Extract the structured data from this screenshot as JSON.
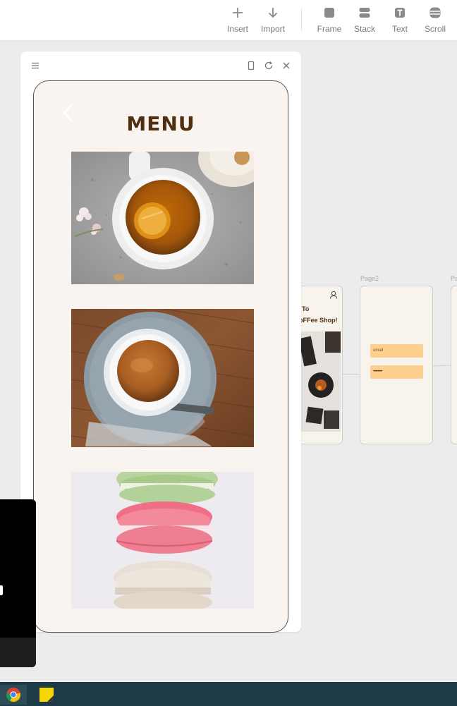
{
  "toolbar": {
    "tools": [
      {
        "id": "insert",
        "label": "Insert",
        "icon": "plus-icon"
      },
      {
        "id": "import",
        "label": "Import",
        "icon": "arrow-down-icon"
      },
      {
        "id": "frame",
        "label": "Frame",
        "icon": "frame-icon"
      },
      {
        "id": "stack",
        "label": "Stack",
        "icon": "stack-icon"
      },
      {
        "id": "text",
        "label": "Text",
        "icon": "text-icon"
      },
      {
        "id": "scroll",
        "label": "Scroll",
        "icon": "scroll-icon"
      }
    ]
  },
  "preview": {
    "controls": [
      "menu-icon",
      "device-icon",
      "refresh-icon",
      "close-icon"
    ],
    "screen": {
      "title": "MENU",
      "items": [
        {
          "name": "tea",
          "icon": "tea-photo"
        },
        {
          "name": "espresso",
          "icon": "espresso-photo"
        },
        {
          "name": "macarons",
          "icon": "macarons-photo"
        }
      ]
    }
  },
  "canvas": {
    "page1": {
      "heading_line1": "To",
      "heading_line2": "oFFee Shop!"
    },
    "page2": {
      "label": "Page2",
      "email_placeholder": "email",
      "password_mask": "••••••••"
    },
    "page3": {
      "label": "Pa"
    }
  },
  "colors": {
    "accent_brown": "#4f2f10",
    "screen_bg": "#f9f4ef",
    "input_orange": "#fdd08f",
    "taskbar": "#1d3b47"
  }
}
